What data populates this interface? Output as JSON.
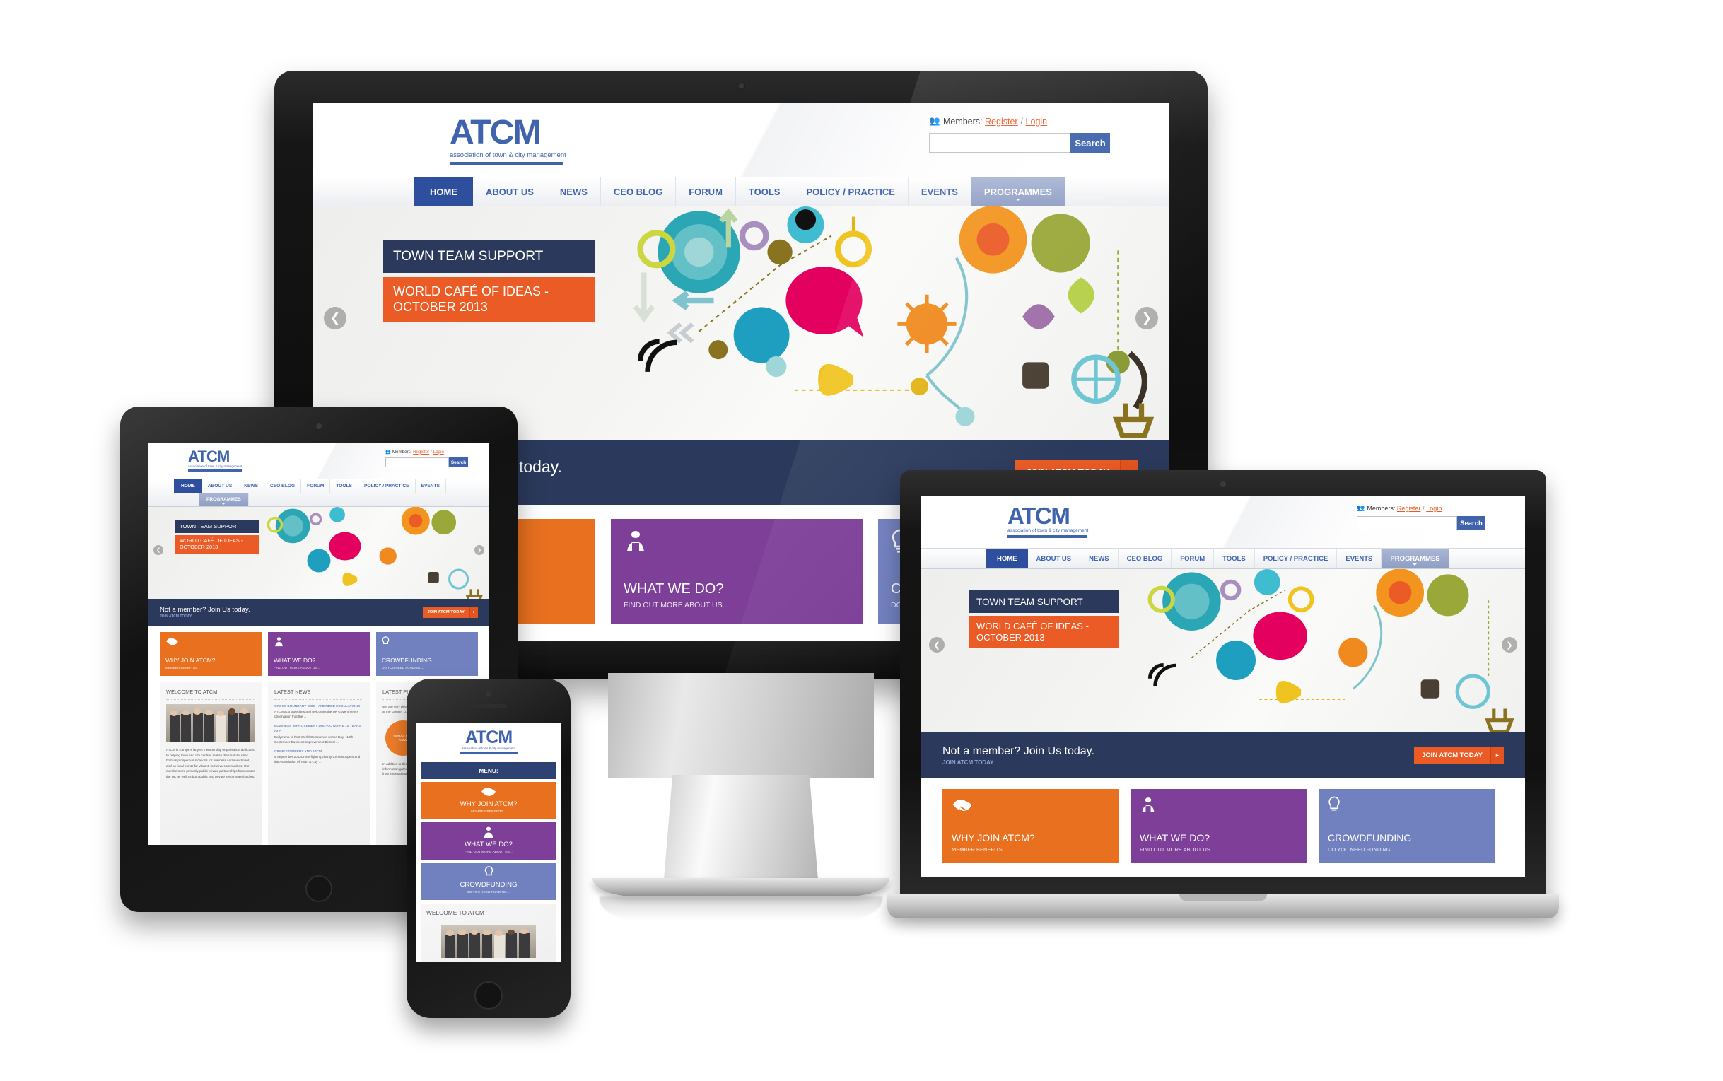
{
  "brand": {
    "logo_mark": "ATCM",
    "logo_sub": "association of town & city management",
    "accent_blue": "#3f64ad",
    "accent_orange": "#ea5b25",
    "navy": "#2b3a5c",
    "purple": "#7d3f98",
    "periwinkle": "#7180bf"
  },
  "header": {
    "members_label": "Members:",
    "register_label": "Register",
    "separator": "/",
    "login_label": "Login",
    "members_icon": "people-icon",
    "search_value": "",
    "search_placeholder": "",
    "search_button": "Search"
  },
  "nav": {
    "items": [
      {
        "label": "HOME",
        "state": "active"
      },
      {
        "label": "ABOUT US",
        "state": "default"
      },
      {
        "label": "NEWS",
        "state": "default"
      },
      {
        "label": "CEO BLOG",
        "state": "default"
      },
      {
        "label": "FORUM",
        "state": "default"
      },
      {
        "label": "TOOLS",
        "state": "default"
      },
      {
        "label": "POLICY / PRACTICE",
        "state": "default"
      },
      {
        "label": "EVENTS",
        "state": "default"
      },
      {
        "label": "PROGRAMMES",
        "state": "dropdown"
      }
    ]
  },
  "hero": {
    "band_top": "TOWN TEAM SUPPORT",
    "band_bottom": "WORLD CAFÉ OF IDEAS - OCTOBER 2013",
    "prev_icon": "chevron-left-icon",
    "next_icon": "chevron-right-icon",
    "artwork": "gears-and-ideas-illustration"
  },
  "cta": {
    "headline": "Not a member? Join Us today.",
    "subline": "JOIN ATCM TODAY",
    "button_label": "JOIN ATCM TODAY",
    "button_arrow": "▸"
  },
  "cards": [
    {
      "title": "WHY JOIN ATCM?",
      "sub": "MEMBER BENEFITS...",
      "icon": "handshake-icon",
      "color": "#e8701f"
    },
    {
      "title": "WHAT WE DO?",
      "sub": "FIND OUT MORE ABOUT US...",
      "icon": "person-briefcase-icon",
      "color": "#7d3f98"
    },
    {
      "title": "CROWDFUNDING",
      "sub": "DO YOU NEED FUNDING....",
      "icon": "lightbulb-icon",
      "color": "#7180bf"
    }
  ],
  "columns": {
    "welcome": {
      "heading": "WELCOME TO ATCM",
      "image_alt": "group-photo",
      "body": "ATCM is Europe's largest membership organisation dedicated to helping town and city centres realise their natural roles both as prosperous locations for business and investment, and as focal points for vibrant, inclusive communities. Our members are primarily public private partnerships from across the UK as well as both public and private sector stakeholders."
    },
    "news": {
      "heading": "LATEST NEWS",
      "items": [
        {
          "title": "CROSS BOUNDARY BIDS - AMENDED REGULATIONS",
          "body": "ATCM acknowledges and welcomes the UK Government's observation that the ..."
        },
        {
          "title": "BUSINESS IMPROVEMENT DISTRICTS ARE 10 YEARS OLD",
          "body": "Ballymena to host World Conference on the Day - 18th September Business Improvement District ..."
        },
        {
          "title": "CRIMESTOPPERS AND ATCM",
          "body": "5 September 2013Crime-fighting charity Crimestoppers and the Association of Town & City ..."
        }
      ]
    },
    "publications": {
      "heading": "LATEST PUBLICATION",
      "body_top": "We are very pleased to present this report which we launched at the Greater London Authority in July 2013.",
      "download_line1": "DOWNLOAD",
      "download_line2": "NOW",
      "body_bottom": "In addition to this report, case studies, research and information gathered from across our partnership network and from international ..."
    }
  },
  "mobile": {
    "menu_label": "MENU:"
  }
}
